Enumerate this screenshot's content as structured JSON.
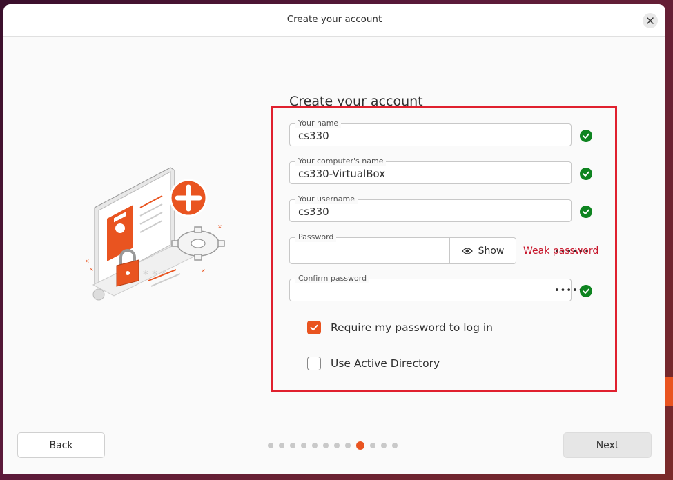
{
  "window": {
    "title": "Create your account"
  },
  "form": {
    "heading": "Create your account",
    "name": {
      "label": "Your name",
      "value": "cs330"
    },
    "computer_name": {
      "label": "Your computer's name",
      "value": "cs330-VirtualBox"
    },
    "username": {
      "label": "Your username",
      "value": "cs330"
    },
    "password": {
      "label": "Password",
      "value": "••••••",
      "show_label": "Show",
      "strength": "Weak password"
    },
    "confirm_password": {
      "label": "Confirm password",
      "value": "••••••"
    },
    "require_password": {
      "label": "Require my password to log in",
      "checked": true
    },
    "active_directory": {
      "label": "Use Active Directory",
      "checked": false
    }
  },
  "nav": {
    "back_label": "Back",
    "next_label": "Next",
    "steps_total": 12,
    "current_step": 9
  },
  "colors": {
    "accent": "#e95420",
    "success": "#0e8420",
    "error": "#c7162b",
    "highlight": "#e0202e"
  }
}
